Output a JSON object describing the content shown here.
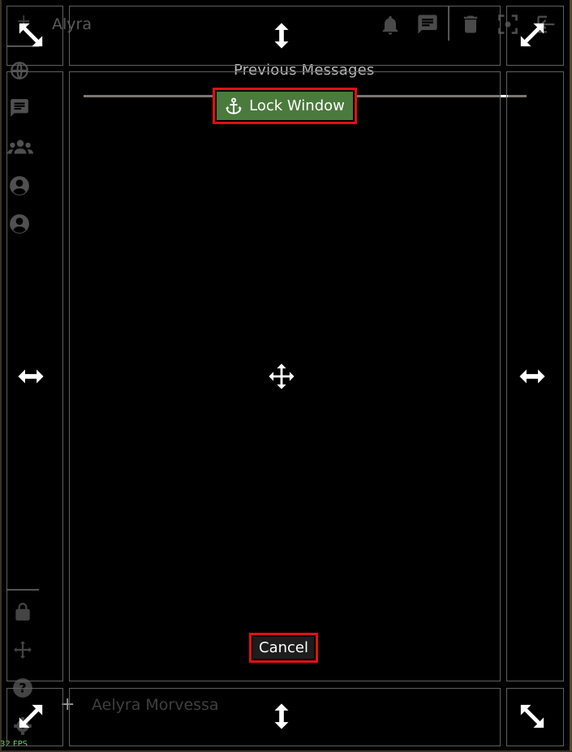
{
  "header": {
    "user_name": "Alyra",
    "icons": [
      "bell-icon",
      "chat-icon",
      "trash-icon",
      "screenshot-icon",
      "exit-icon"
    ]
  },
  "chat": {
    "title": "Previous Messages"
  },
  "sidebar": {
    "icons": [
      "globe-icon",
      "chat-icon",
      "group-icon",
      "profile-icon",
      "profile-icon",
      "lock-icon",
      "move-icon",
      "help-icon",
      "settings-icon"
    ]
  },
  "footer": {
    "plus_glyph": "+",
    "character_name": "Aelyra Morvessa"
  },
  "overlay": {
    "lock_label": "Lock Window",
    "cancel_label": "Cancel"
  },
  "status": {
    "fps": "32 FPS"
  },
  "colors": {
    "lock_button_bg": "#4b7a3d",
    "highlight_border": "#e11010",
    "fps_text": "#6ad36a"
  }
}
